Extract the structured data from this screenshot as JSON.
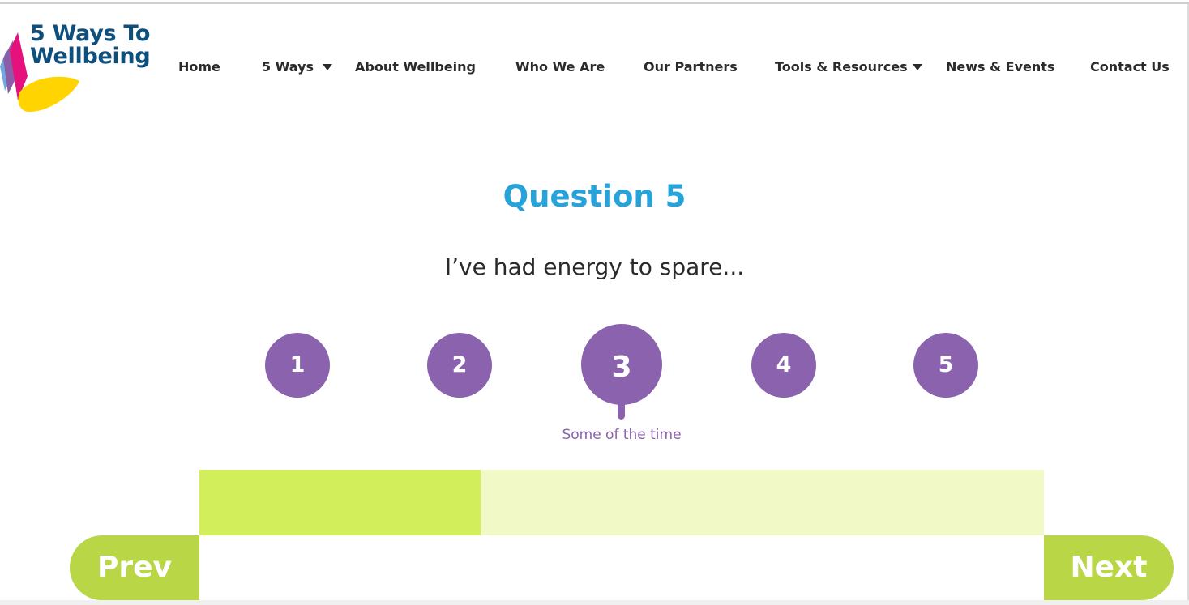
{
  "logo": {
    "line1": "5 Ways To",
    "line2": "Wellbeing",
    "colors": [
      "#e5127d",
      "#8b5ca8",
      "#ffd400",
      "#0e4f7c"
    ]
  },
  "nav": {
    "items": [
      {
        "label": "Home"
      },
      {
        "label": "5 Ways",
        "has_dropdown": true,
        "icon": "caret-down-icon"
      },
      {
        "label": "About Wellbeing"
      },
      {
        "label": "Who We Are"
      },
      {
        "label": "Our Partners"
      },
      {
        "label": "Tools & Resources",
        "has_dropdown": true,
        "icon": "caret-down-icon"
      },
      {
        "label": "News & Events"
      },
      {
        "label": "Contact Us"
      }
    ]
  },
  "question": {
    "title": "Question 5",
    "text": "I’ve had energy to spare...",
    "options": [
      "1",
      "2",
      "3",
      "4",
      "5"
    ],
    "selected": "3",
    "selected_caption": "Some of the time"
  },
  "progress": {
    "fraction": 0.333
  },
  "buttons": {
    "prev": "Prev",
    "next": "Next"
  },
  "colors": {
    "accent_blue": "#27a3dc",
    "option_purple": "#8a62ad",
    "progress_fill": "#d2ee5b",
    "progress_track": "#f1f9c7",
    "button_green": "#b8d645"
  }
}
